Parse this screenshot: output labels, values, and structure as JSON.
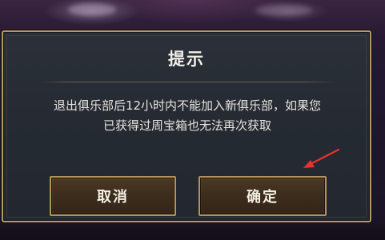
{
  "dialog": {
    "title": "提示",
    "message_lines": [
      "退出俱乐部后12小时内不能加入新俱乐部，如果您",
      "已获得过周宝箱也无法再次获取"
    ],
    "buttons": {
      "cancel_label": "取消",
      "confirm_label": "确定"
    }
  },
  "colors": {
    "border_gold": "#b79a63",
    "button_fill": "#3c2c1b",
    "dialog_fill": "#262b34",
    "annotation_arrow": "#e8322d"
  }
}
